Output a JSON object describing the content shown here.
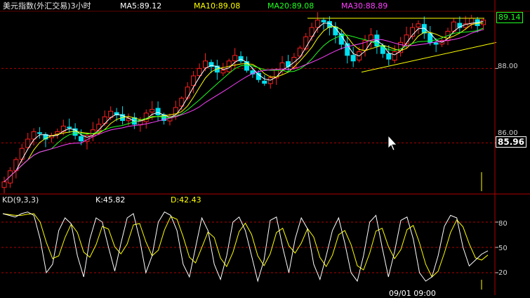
{
  "header": {
    "title": "美元指数(外汇交易)3小时",
    "ma5": "MA5:89.12",
    "ma10": "MA10:89.08",
    "ma20": "MA20:89.08",
    "ma30": "MA30:88.89"
  },
  "kd_header": {
    "name": "KD(9,3,3)",
    "k": "K:45.82",
    "d": "D:42.43"
  },
  "price_axis": {
    "top_box": "89.14",
    "label_88": "88.00",
    "label_86": "86.00",
    "current_box": "85.96"
  },
  "kd_axis": {
    "label_80": "80",
    "label_50": "50",
    "label_20": "20"
  },
  "bottom_time_partial": "09/01 09:00",
  "colors": {
    "up": "#ff2020",
    "down": "#00e0f0",
    "ma5": "#ffffff",
    "ma10": "#ffff00",
    "ma20": "#20ff20",
    "ma30": "#ff40ff",
    "grid": "#b00000",
    "k_line": "#ffffff",
    "d_line": "#ffff00",
    "trend": "#ffff00"
  },
  "chart_data": {
    "type": "candlestick",
    "price_range": [
      84.7,
      89.5
    ],
    "price_gridlines": [
      88.0,
      86.0
    ],
    "closes": [
      84.95,
      85.25,
      85.55,
      85.85,
      86.1,
      86.3,
      86.25,
      86.1,
      86.2,
      86.3,
      86.45,
      86.4,
      86.2,
      86.05,
      86.2,
      86.35,
      86.5,
      86.7,
      86.85,
      86.75,
      86.6,
      86.65,
      86.5,
      86.6,
      86.8,
      86.9,
      86.75,
      86.6,
      86.7,
      86.95,
      87.2,
      87.5,
      87.8,
      88.0,
      88.2,
      88.05,
      87.9,
      87.95,
      88.2,
      88.35,
      88.2,
      87.95,
      87.85,
      87.7,
      87.6,
      87.75,
      87.95,
      88.15,
      88.05,
      88.3,
      88.55,
      88.85,
      89.1,
      89.3,
      89.25,
      89.1,
      88.9,
      88.65,
      88.35,
      88.2,
      88.45,
      88.75,
      88.9,
      88.6,
      88.4,
      88.25,
      88.45,
      88.7,
      88.9,
      89.1,
      89.2,
      88.95,
      88.7,
      88.65,
      88.75,
      89.0,
      89.25,
      89.1,
      89.2,
      89.35,
      89.15,
      89.3
    ]
  },
  "kd_data": {
    "range": [
      0,
      100
    ],
    "gridlines": [
      80,
      50,
      20
    ],
    "k": [
      90,
      88,
      86,
      90,
      92,
      88,
      60,
      20,
      30,
      70,
      85,
      78,
      40,
      15,
      60,
      85,
      80,
      50,
      22,
      55,
      85,
      90,
      60,
      20,
      40,
      80,
      92,
      88,
      70,
      30,
      15,
      50,
      85,
      70,
      30,
      12,
      40,
      80,
      86,
      70,
      40,
      10,
      35,
      82,
      86,
      50,
      20,
      60,
      85,
      72,
      30,
      12,
      40,
      70,
      85,
      55,
      20,
      10,
      40,
      80,
      88,
      50,
      15,
      45,
      82,
      86,
      60,
      20,
      10,
      15,
      40,
      75,
      88,
      85,
      50,
      28,
      35,
      42,
      46
    ]
  }
}
